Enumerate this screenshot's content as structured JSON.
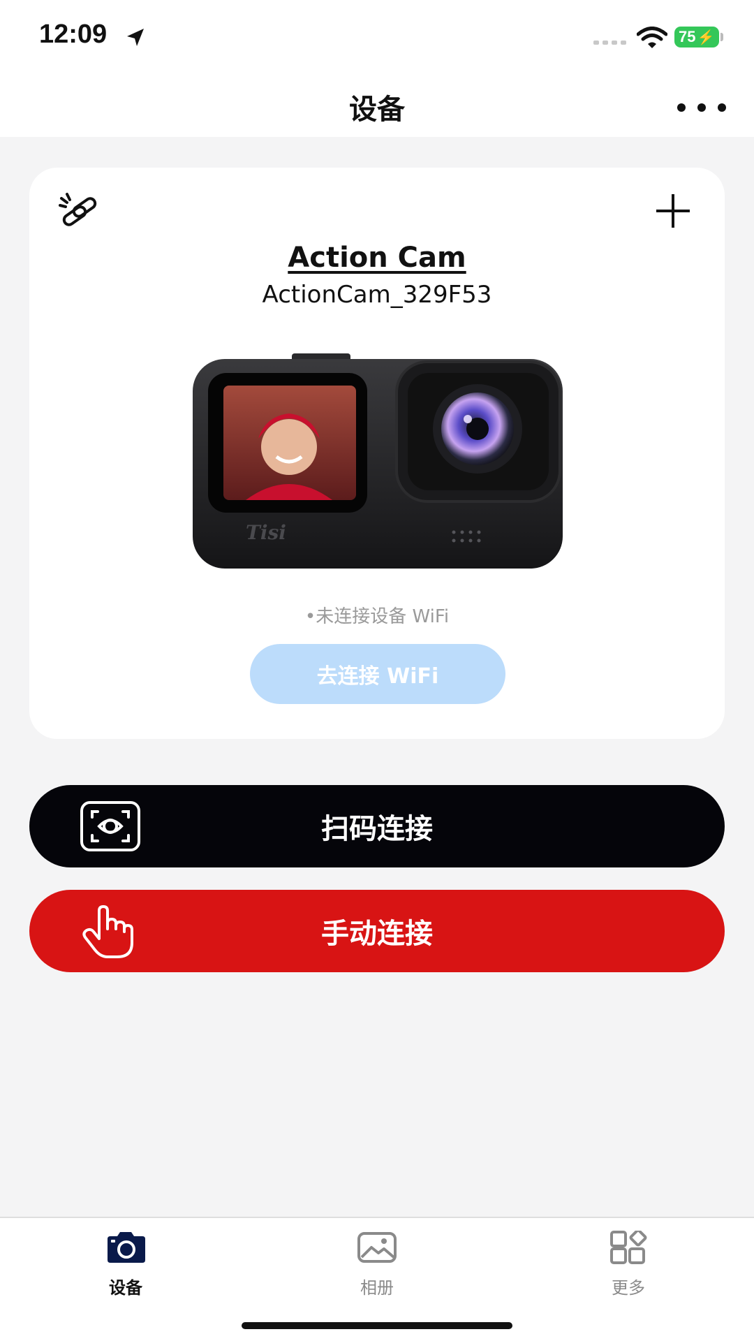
{
  "status_bar": {
    "time": "12:09",
    "battery_percent": "75",
    "icons": [
      "location-arrow-icon",
      "cellular-signal-icon",
      "wifi-icon",
      "battery-charging-icon"
    ]
  },
  "nav": {
    "title": "设备",
    "more_icon": "ellipsis-icon"
  },
  "device_card": {
    "name": "Action Cam",
    "ssid": "ActionCam_329F53",
    "camera_brand": "Tisi",
    "wifi_status": "•未连接设备 WiFi",
    "connect_button": "去连接 WiFi",
    "icons": [
      "unlink-icon",
      "add-icon"
    ]
  },
  "actions": {
    "scan_label": "扫码连接",
    "manual_label": "手动连接"
  },
  "tabs": [
    {
      "label": "设备",
      "icon": "camera-icon",
      "active": true
    },
    {
      "label": "相册",
      "icon": "image-icon",
      "active": false
    },
    {
      "label": "更多",
      "icon": "apps-grid-icon",
      "active": false
    }
  ],
  "colors": {
    "scan_button": "#05050a",
    "manual_button": "#d81414",
    "connect_button": "#bcdcfb",
    "battery": "#34c759",
    "active_tab": "#0a1a4a"
  }
}
